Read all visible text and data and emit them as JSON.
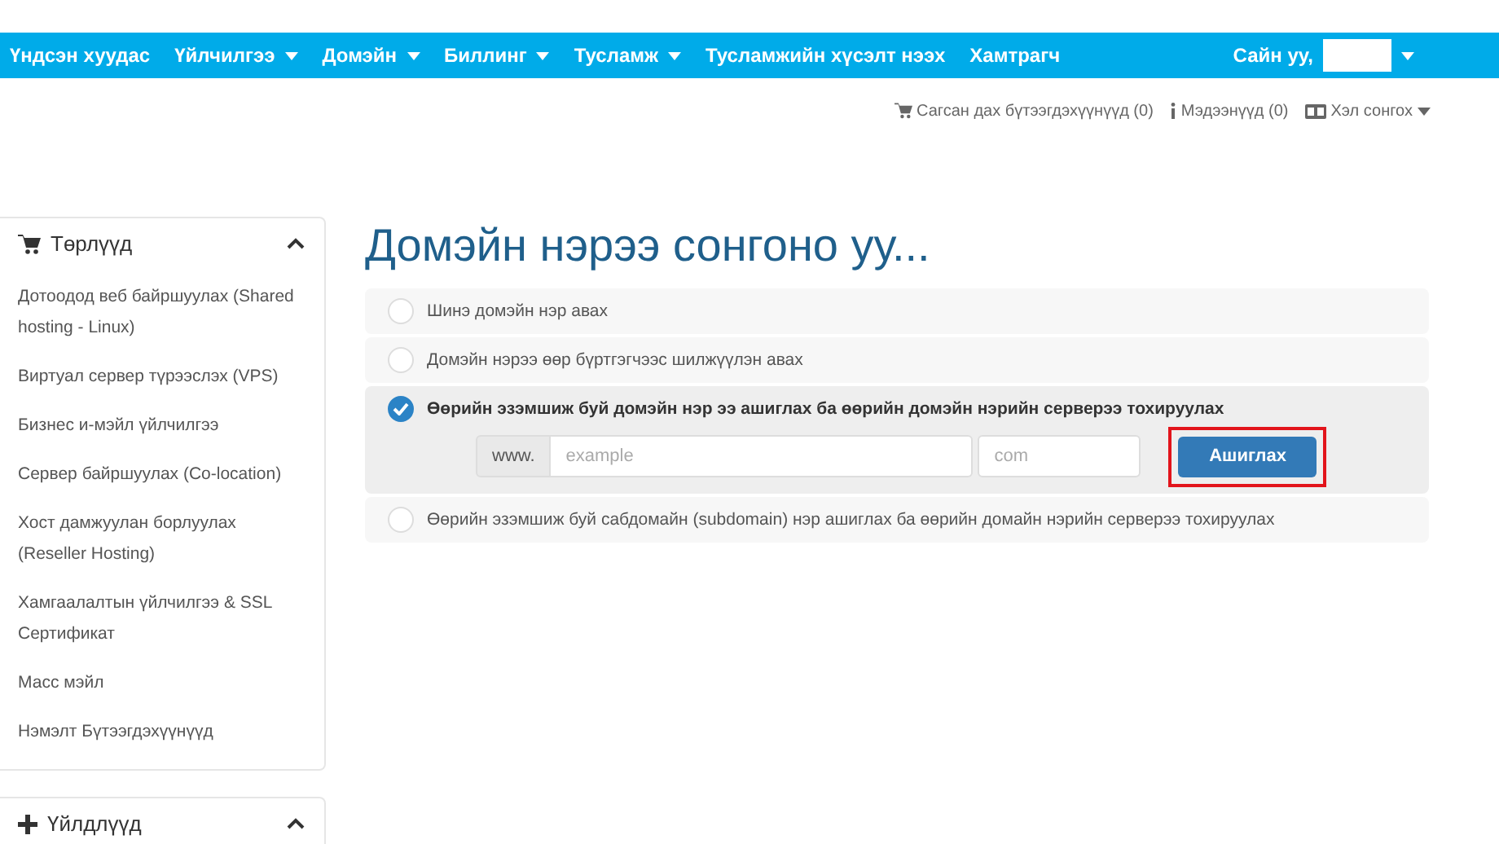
{
  "navbar": {
    "items": [
      {
        "label": "Үндсэн хуудас",
        "dropdown": false
      },
      {
        "label": "Үйлчилгээ",
        "dropdown": true
      },
      {
        "label": "Домэйн",
        "dropdown": true
      },
      {
        "label": "Биллинг",
        "dropdown": true
      },
      {
        "label": "Тусламж",
        "dropdown": true
      },
      {
        "label": "Тусламжийн хүсэлт нээх",
        "dropdown": false
      },
      {
        "label": "Хамтрагч",
        "dropdown": false
      }
    ],
    "greeting": "Сайн уу,"
  },
  "top_links": [
    {
      "kind": "cart",
      "label": "Сагсан дах бүтээгдэхүүнүүд (0)"
    },
    {
      "kind": "info",
      "label": "Мэдээнүүд (0)"
    },
    {
      "kind": "language",
      "label": "Хэл сонгох"
    }
  ],
  "sidebar": {
    "panels": [
      {
        "kind": "cart",
        "title": "Төрлүүд",
        "expanded": true,
        "items": [
          "Дотоодод веб байршуулах (Shared hosting - Linux)",
          "Виртуал сервер түрээслэх (VPS)",
          "Бизнес и-мэйл үйлчилгээ",
          "Сервер байршуулах (Co-location)",
          "Хост дамжуулан борлуулах (Reseller Hosting)",
          "Хамгаалалтын үйлчилгээ & SSL Сертификат",
          "Масс мэйл",
          "Нэмэлт Бүтээгдэхүүнүүд"
        ]
      },
      {
        "kind": "plus",
        "title": "Үйлдлүүд",
        "expanded": true
      }
    ]
  },
  "main": {
    "title": "Домэйн нэрээ сонгоно уу...",
    "options": [
      {
        "label": "Шинэ домэйн нэр авах",
        "selected": false
      },
      {
        "label": "Домэйн нэрээ өөр бүртгэгчээс шилжүүлэн авах",
        "selected": false
      },
      {
        "label": "Өөрийн эзэмшиж буй домэйн нэр ээ ашиглах ба өөрийн домэйн нэрийн серверээ тохируулах",
        "selected": true
      },
      {
        "label": "Өөрийн эзэмшиж буй сабдомайн (subdomain) нэр ашиглах ба өөрийн домайн нэрийн серверээ тохируулах",
        "selected": false
      }
    ],
    "domain_form": {
      "prefix": "www.",
      "name_placeholder": "example",
      "tld_placeholder": "com",
      "button": "Ашиглах",
      "highlighted": true
    }
  }
}
